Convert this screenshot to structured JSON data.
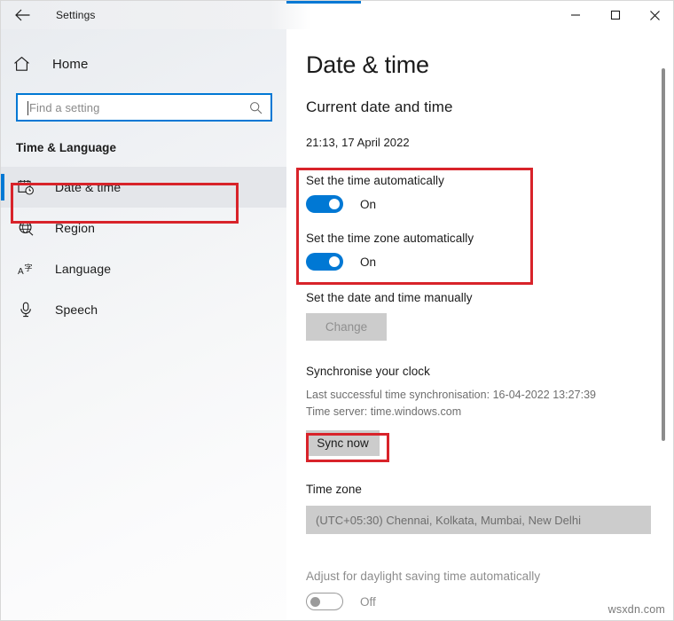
{
  "window": {
    "title": "Settings",
    "back_icon": "back-arrow-icon",
    "minimize_label": "Minimise",
    "maximize_label": "Maximise",
    "close_label": "Close"
  },
  "sidebar": {
    "home": {
      "label": "Home",
      "icon": "home-icon"
    },
    "search": {
      "placeholder": "Find a setting",
      "value": "",
      "icon": "search-icon"
    },
    "group_title": "Time & Language",
    "items": [
      {
        "label": "Date & time",
        "icon": "calendar-clock-icon",
        "selected": true
      },
      {
        "label": "Region",
        "icon": "globe-icon",
        "selected": false
      },
      {
        "label": "Language",
        "icon": "language-icon",
        "selected": false
      },
      {
        "label": "Speech",
        "icon": "microphone-icon",
        "selected": false
      }
    ]
  },
  "main": {
    "page_title": "Date & time",
    "current_section": {
      "heading": "Current date and time",
      "value": "21:13, 17 April 2022"
    },
    "auto_time": {
      "label": "Set the time automatically",
      "state": "On",
      "on": true
    },
    "auto_timezone": {
      "label": "Set the time zone automatically",
      "state": "On",
      "on": true
    },
    "manual": {
      "label": "Set the date and time manually",
      "button_label": "Change",
      "disabled": true
    },
    "sync": {
      "heading": "Synchronise your clock",
      "last_sync": "Last successful time synchronisation: 16-04-2022 13:27:39",
      "time_server": "Time server: time.windows.com",
      "button_label": "Sync now"
    },
    "timezone": {
      "heading": "Time zone",
      "selected": "(UTC+05:30) Chennai, Kolkata, Mumbai, New Delhi",
      "disabled": true
    },
    "dst": {
      "label": "Adjust for daylight saving time automatically",
      "state": "Off",
      "on": false
    }
  },
  "annotations": {
    "color": "#d8232a",
    "boxes": [
      "date-time-sidebar-item",
      "automatic-time-toggles",
      "sync-now-button"
    ]
  },
  "watermark": "wsxdn.com",
  "colors": {
    "accent": "#0078d4",
    "annotation_red": "#d8232a",
    "disabled_grey": "#cccccc"
  }
}
